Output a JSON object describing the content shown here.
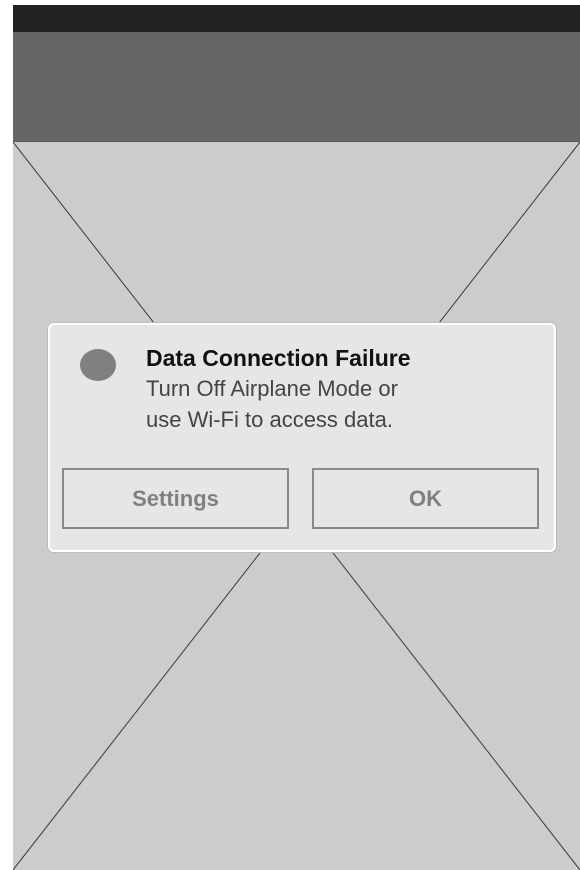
{
  "colors": {
    "status_bar": "#222222",
    "nav_bar": "#666666",
    "content_bg": "#cccccc",
    "dialog_bg": "#e6e6e6",
    "dialog_icon": "#808080",
    "button_text": "#808080"
  },
  "dialog": {
    "icon": "status-dot-icon",
    "title": "Data Connection Failure",
    "message_line1": "Turn Off Airplane Mode or",
    "message_line2": "use Wi-Fi to access data.",
    "buttons": {
      "settings_label": "Settings",
      "ok_label": "OK"
    }
  }
}
